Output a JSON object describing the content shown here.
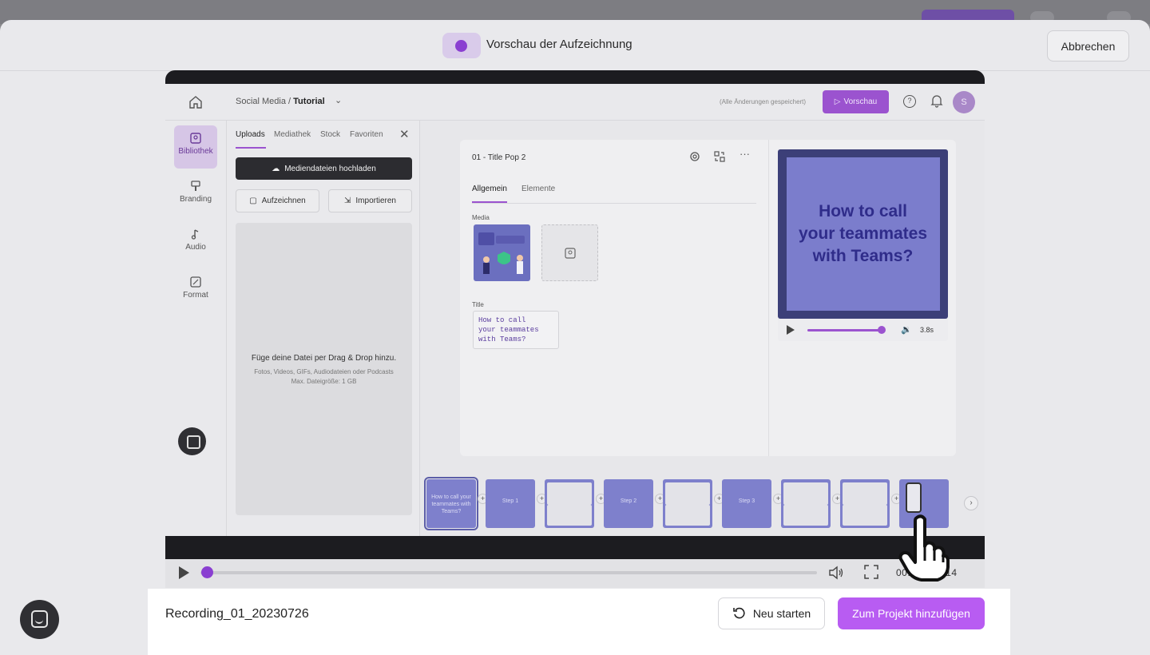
{
  "header": {
    "title": "Vorschau der Aufzeichnung",
    "cancel_label": "Abbrechen"
  },
  "inner_app": {
    "breadcrumb_project": "Social Media /",
    "breadcrumb_page": "Tutorial",
    "saved_status": "(Alle Änderungen gespeichert)",
    "preview_button": "Vorschau",
    "avatar_initial": "S",
    "nav": [
      {
        "label": "Bibliothek",
        "icon": "library-icon"
      },
      {
        "label": "Branding",
        "icon": "brush-icon"
      },
      {
        "label": "Audio",
        "icon": "music-note-icon"
      },
      {
        "label": "Format",
        "icon": "resize-icon"
      }
    ],
    "panel": {
      "tabs": [
        "Uploads",
        "Mediathek",
        "Stock",
        "Favoriten"
      ],
      "upload_button": "Mediendateien hochladen",
      "record_button": "Aufzeichnen",
      "import_button": "Importieren",
      "dropzone_title": "Füge deine Datei per Drag & Drop hinzu.",
      "dropzone_sub1": "Fotos, Videos, GIFs, Audiodateien oder Podcasts",
      "dropzone_sub2": "Max. Dateigröße: 1 GB"
    },
    "editor": {
      "scene_title": "01 - Title Pop 2",
      "tabs": [
        "Allgemein",
        "Elemente"
      ],
      "media_label": "Media",
      "title_label": "Title",
      "title_lines": [
        "How to call",
        "your teammates",
        "with Teams?"
      ],
      "preview_lines": [
        "How to call",
        "your teammates",
        "with Teams?"
      ],
      "duration": "3.8s",
      "progress_fraction": 0.95
    },
    "filmstrip": {
      "clips": [
        {
          "label": "How to call your teammates with Teams?",
          "kind": "title"
        },
        {
          "label": "Step 1",
          "kind": "step"
        },
        {
          "label": "",
          "kind": "shot"
        },
        {
          "label": "Step 2",
          "kind": "step"
        },
        {
          "label": "",
          "kind": "shot"
        },
        {
          "label": "Step 3",
          "kind": "step"
        },
        {
          "label": "",
          "kind": "shot"
        },
        {
          "label": "",
          "kind": "shot"
        },
        {
          "label": "",
          "kind": "phone"
        }
      ]
    }
  },
  "player": {
    "current_time": "00:00",
    "total_time": "00:14",
    "progress_fraction": 0.01
  },
  "footer": {
    "recording_name": "Recording_01_20230726",
    "restart_label": "Neu starten",
    "add_label": "Zum Projekt hinzufügen"
  },
  "colors": {
    "accent": "#b85cf2",
    "record_dot": "#8a3fd1"
  }
}
